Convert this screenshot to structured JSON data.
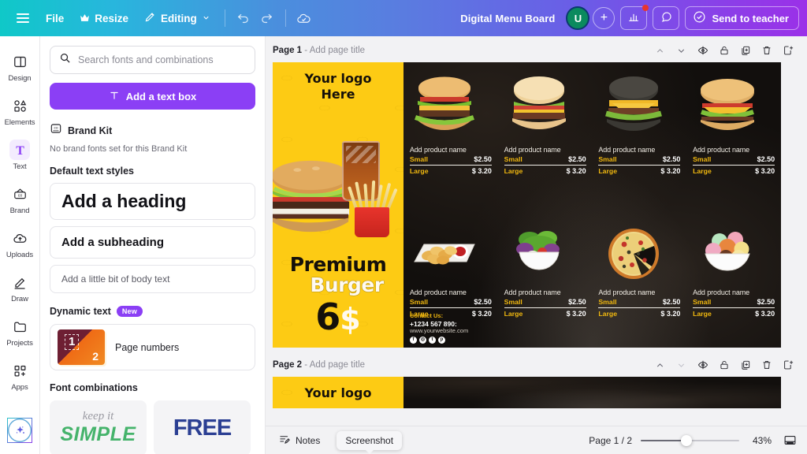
{
  "topbar": {
    "menu_icon": "hamburger-icon",
    "file_label": "File",
    "resize_label": "Resize",
    "resize_icon": "crown-icon",
    "editing_label": "Editing",
    "editing_icon": "pencil-icon",
    "chevron_icon": "chevron-down-icon",
    "undo_icon": "undo-icon",
    "redo_icon": "redo-icon",
    "cloud_icon": "cloud-saved-icon",
    "doc_title": "Digital Menu Board",
    "avatar_initial": "U",
    "avatar_label": "user-avatar",
    "plus_label": "+",
    "analytics_icon": "bar-chart-icon",
    "comment_icon": "comment-icon",
    "send_icon": "check-circle-icon",
    "send_label": "Send to teacher"
  },
  "rail": {
    "items": [
      {
        "label": "Design",
        "icon": "design-icon"
      },
      {
        "label": "Elements",
        "icon": "elements-icon"
      },
      {
        "label": "Text",
        "icon": "text-icon"
      },
      {
        "label": "Brand",
        "icon": "brand-icon"
      },
      {
        "label": "Uploads",
        "icon": "uploads-icon"
      },
      {
        "label": "Draw",
        "icon": "draw-icon"
      },
      {
        "label": "Projects",
        "icon": "projects-icon"
      },
      {
        "label": "Apps",
        "icon": "apps-icon"
      }
    ],
    "active": "Text",
    "ai_orb_icon": "magic-sparkle-icon"
  },
  "panel": {
    "search": {
      "placeholder": "Search fonts and combinations",
      "value": "",
      "icon": "search-icon"
    },
    "add_text_box": {
      "label": "Add a text box",
      "icon": "text-t-icon"
    },
    "brand_kit": {
      "title": "Brand Kit",
      "icon": "brand-kit-icon",
      "note": "No brand fonts set for this Brand Kit"
    },
    "default_text_styles": {
      "title": "Default text styles",
      "items": [
        {
          "label": "Add a heading"
        },
        {
          "label": "Add a subheading"
        },
        {
          "label": "Add a little bit of body text"
        }
      ]
    },
    "dynamic_text": {
      "title": "Dynamic text",
      "badge": "New",
      "item_label": "Page numbers",
      "thumb_num1": "1",
      "thumb_num2": "2"
    },
    "font_combinations": {
      "title": "Font combinations",
      "items": [
        {
          "line1": "keep it",
          "line2": "SIMPLE"
        },
        {
          "line1": "FREE",
          "line2": ""
        }
      ]
    }
  },
  "canvas": {
    "pages": [
      {
        "label": "Page 1",
        "separator": "-",
        "title_placeholder": "Add page title",
        "tools": [
          "collapse-up-icon",
          "expand-down-icon",
          "hide-page-icon",
          "lock-page-icon",
          "duplicate-page-icon",
          "delete-page-icon",
          "add-page-icon"
        ]
      },
      {
        "label": "Page 2",
        "separator": "-",
        "title_placeholder": "Add page title",
        "tools": [
          "collapse-up-icon",
          "expand-down-icon",
          "hide-page-icon",
          "lock-page-icon",
          "duplicate-page-icon",
          "delete-page-icon",
          "add-page-icon"
        ]
      }
    ],
    "design": {
      "promo": {
        "logo_line1": "Your logo",
        "logo_line2": "Here",
        "title_line1": "Premium",
        "title_line2": "Burger",
        "price_number": "6",
        "price_currency": "$",
        "bg_color": "#fdcb14"
      },
      "products": [
        {
          "name": "Add product name",
          "small_label": "Small",
          "small_price": "$2.50",
          "large_label": "Large",
          "large_price": "$ 3.20",
          "image": "burger-lettuce-tomato"
        },
        {
          "name": "Add product name",
          "small_label": "Small",
          "small_price": "$2.50",
          "large_label": "Large",
          "large_price": "$ 3.20",
          "image": "burger-classic"
        },
        {
          "name": "Add product name",
          "small_label": "Small",
          "small_price": "$2.50",
          "large_label": "Large",
          "large_price": "$ 3.20",
          "image": "burger-black-bun"
        },
        {
          "name": "Add product name",
          "small_label": "Small",
          "small_price": "$2.50",
          "large_label": "Large",
          "large_price": "$ 3.20",
          "image": "burger-cheese"
        },
        {
          "name": "Add product name",
          "small_label": "Small",
          "small_price": "$2.50",
          "large_label": "Large",
          "large_price": "$ 3.20",
          "image": "nuggets-ketchup"
        },
        {
          "name": "Add product name",
          "small_label": "Small",
          "small_price": "$2.50",
          "large_label": "Large",
          "large_price": "$ 3.20",
          "image": "salad-bowl"
        },
        {
          "name": "Add product name",
          "small_label": "Small",
          "small_price": "$2.50",
          "large_label": "Large",
          "large_price": "$ 3.20",
          "image": "pizza-sliced"
        },
        {
          "name": "Add product name",
          "small_label": "Small",
          "small_price": "$2.50",
          "large_label": "Large",
          "large_price": "$ 3.20",
          "image": "ice-cream-bowl"
        }
      ],
      "contact": {
        "heading": "Contact Us:",
        "phone": "+1234 567 890:",
        "website": "www.yourwebsite.com",
        "socials": [
          "facebook-icon",
          "instagram-icon",
          "twitter-icon",
          "pinterest-icon"
        ]
      },
      "accent_color": "#f2b90f"
    }
  },
  "bottombar": {
    "notes_label": "Notes",
    "notes_icon": "notes-icon",
    "tooltip": "Screenshot",
    "page_indicator": "Page 1 / 2",
    "zoom_value": "43%",
    "grid_view_icon": "grid-view-icon"
  }
}
